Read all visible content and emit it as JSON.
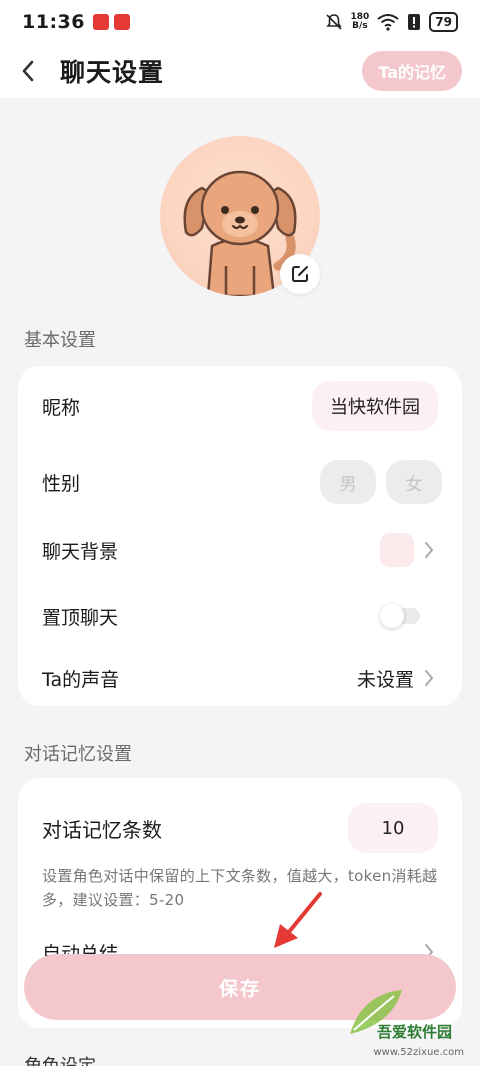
{
  "status": {
    "time": "11:36",
    "net_speed_top": "180",
    "net_speed_bottom": "B/s",
    "battery": "79"
  },
  "header": {
    "title": "聊天设置",
    "memory_button": "Ta的记忆"
  },
  "basic": {
    "section_title": "基本设置",
    "nickname_label": "昵称",
    "nickname_value": "当快软件园",
    "gender_label": "性别",
    "gender_male": "男",
    "gender_female": "女",
    "background_label": "聊天背景",
    "pin_label": "置顶聊天",
    "voice_label": "Ta的声音",
    "voice_value": "未设置"
  },
  "memory": {
    "section_title": "对话记忆设置",
    "count_label": "对话记忆条数",
    "count_value": "10",
    "description": "设置角色对话中保留的上下文条数，值越大，token消耗越多，建议设置：5-20",
    "auto_summary_label": "自动总结"
  },
  "role_section_title": "角色设定",
  "save_button": "保存",
  "watermark": {
    "name": "吾爱软件园",
    "url": "www.52zixue.com"
  },
  "colors": {
    "accent_pink": "#f4c7cd",
    "arrow_red": "#e53935"
  }
}
